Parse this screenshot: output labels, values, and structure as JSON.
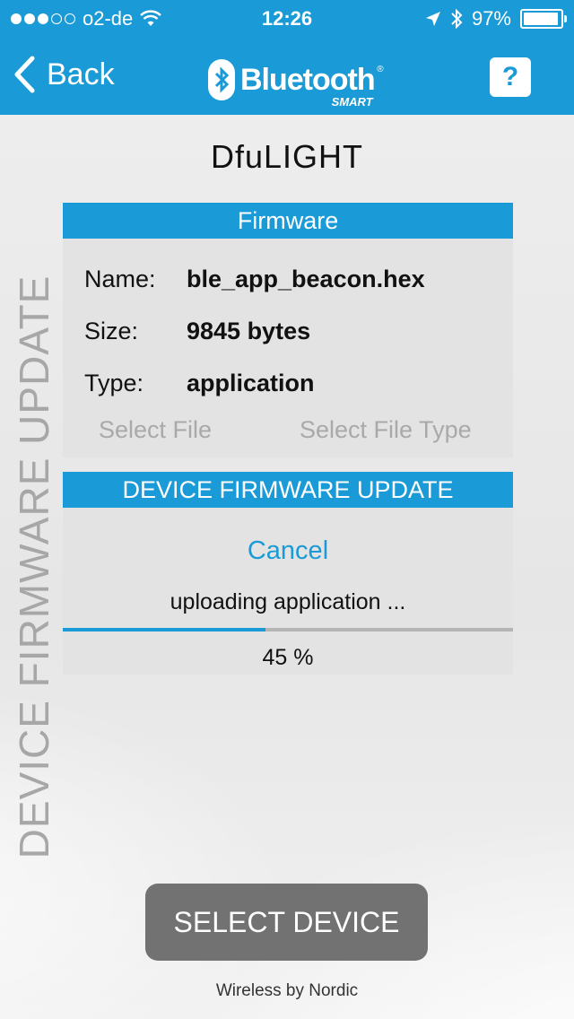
{
  "status_bar": {
    "carrier": "o2-de",
    "time": "12:26",
    "battery_percent": "97%"
  },
  "nav": {
    "back_label": "Back",
    "brand_name": "Bluetooth",
    "brand_sub": "SMART",
    "help_label": "?"
  },
  "device_name": "DfuLIGHT",
  "side_label": "DEVICE FIRMWARE UPDATE",
  "firmware": {
    "header": "Firmware",
    "name_label": "Name:",
    "name_value": "ble_app_beacon.hex",
    "size_label": "Size:",
    "size_value": "9845 bytes",
    "type_label": "Type:",
    "type_value": "application",
    "select_file": "Select File",
    "select_file_type": "Select File Type"
  },
  "dfu": {
    "header": "DEVICE FIRMWARE UPDATE",
    "cancel": "Cancel",
    "status": "uploading application ...",
    "percent_text": "45 %",
    "progress": 0.45
  },
  "select_device": "SELECT DEVICE",
  "footer": "Wireless by Nordic",
  "colors": {
    "accent": "#1a9ad6",
    "button_gray": "#727272"
  }
}
